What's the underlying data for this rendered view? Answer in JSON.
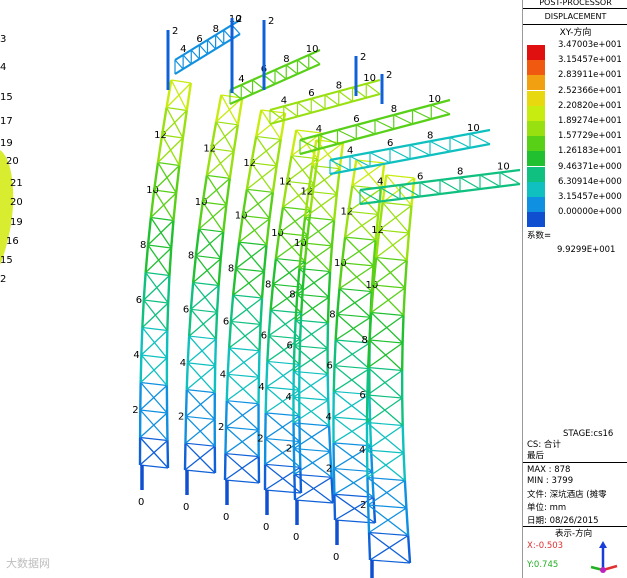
{
  "panel": {
    "header_top": "POST-PROCESSOR",
    "header_type": "DISPLACEMENT",
    "direction": "XY-方向",
    "legend": [
      {
        "value": "3.47003e+001",
        "color": "#e01010"
      },
      {
        "value": "3.15457e+001",
        "color": "#f05a10"
      },
      {
        "value": "2.83911e+001",
        "color": "#f0a010"
      },
      {
        "value": "2.52366e+001",
        "color": "#e8d810"
      },
      {
        "value": "2.20820e+001",
        "color": "#c8ec10"
      },
      {
        "value": "1.89274e+001",
        "color": "#98e010"
      },
      {
        "value": "1.57729e+001",
        "color": "#58d018"
      },
      {
        "value": "1.26183e+001",
        "color": "#20c030"
      },
      {
        "value": "9.46371e+000",
        "color": "#10c080"
      },
      {
        "value": "6.30914e+000",
        "color": "#10c0c0"
      },
      {
        "value": "3.15457e+000",
        "color": "#1090e0"
      },
      {
        "value": "0.00000e+000",
        "color": "#1050d0"
      }
    ],
    "factor_label": "系数=",
    "factor_value": "9.9299E+001",
    "stage": "STAGE:cs16",
    "cs": "CS: 合计",
    "last": "最后",
    "max": "MAX : 878",
    "min": "MIN : 3799",
    "file": "文件: 深坑酒店 (摊零",
    "unit": "单位: mm",
    "date": "日期: 08/26/2015",
    "view_dir": "表示-方向",
    "x_coord": "X:-0.503",
    "y_coord": "Y:0.745"
  },
  "viewport": {
    "left_edge_labels": [
      "3",
      "4",
      "15",
      "17",
      "19",
      "20",
      "21",
      "20",
      "19",
      "16",
      "15",
      "2"
    ],
    "watermark": "大数据网"
  }
}
